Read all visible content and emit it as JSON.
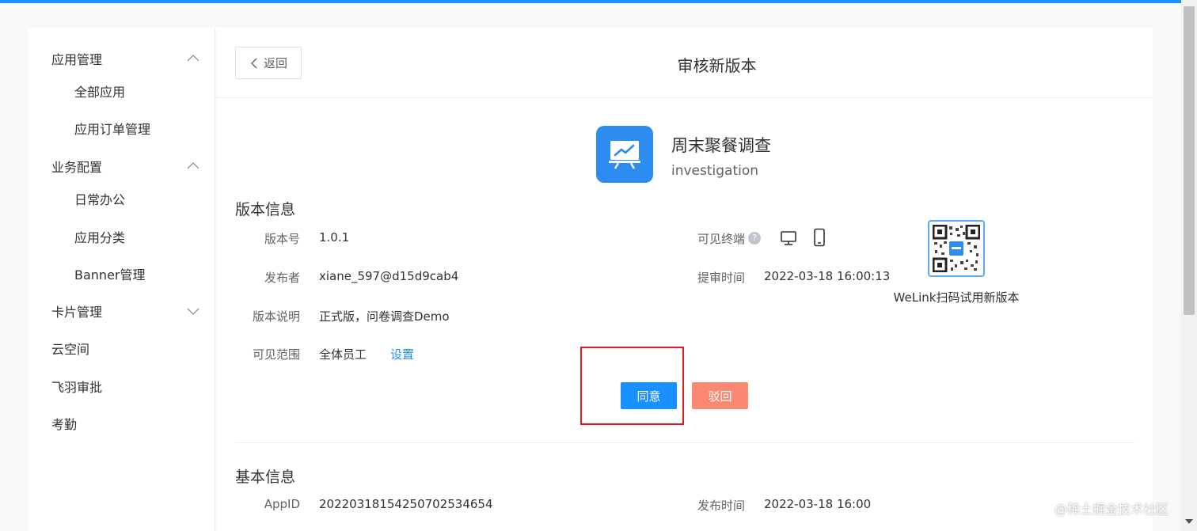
{
  "sidebar": {
    "groups": [
      {
        "label": "应用管理",
        "expanded": true,
        "items": [
          "全部应用",
          "应用订单管理"
        ]
      },
      {
        "label": "业务配置",
        "expanded": true,
        "items": [
          "日常办公",
          "应用分类",
          "Banner管理"
        ]
      },
      {
        "label": "卡片管理",
        "expanded": false,
        "items": []
      }
    ],
    "items": [
      "云空间",
      "飞羽审批",
      "考勤"
    ]
  },
  "header": {
    "back_label": "返回",
    "title": "审核新版本"
  },
  "app": {
    "name": "周末聚餐调查",
    "sub": "investigation",
    "icon": "presentation-chart-icon",
    "icon_color": "#2d8cf0"
  },
  "version_info": {
    "title": "版本信息",
    "version_label": "版本号",
    "version_value": "1.0.1",
    "publisher_label": "发布者",
    "publisher_value": "xiane_597@d15d9cab4",
    "desc_label": "版本说明",
    "desc_value": "正式版，问卷调查Demo",
    "scope_label": "可见范围",
    "scope_value": "全体员工",
    "scope_link": "设置",
    "terminal_label": "可见终端",
    "terminal_help": "?",
    "submit_time_label": "提审时间",
    "submit_time_value": "2022-03-18 16:00:13",
    "qr_caption": "WeLink扫码试用新版本"
  },
  "actions": {
    "agree": "同意",
    "reject": "驳回",
    "agree_color": "#1890ff",
    "reject_color": "#fa8872"
  },
  "basic_info": {
    "title": "基本信息",
    "appid_label": "AppID",
    "appid_value": "20220318154250702534654",
    "publish_time_label": "发布时间",
    "publish_time_value": "2022-03-18 16:00"
  },
  "watermark": "@稀土掘金技术社区"
}
